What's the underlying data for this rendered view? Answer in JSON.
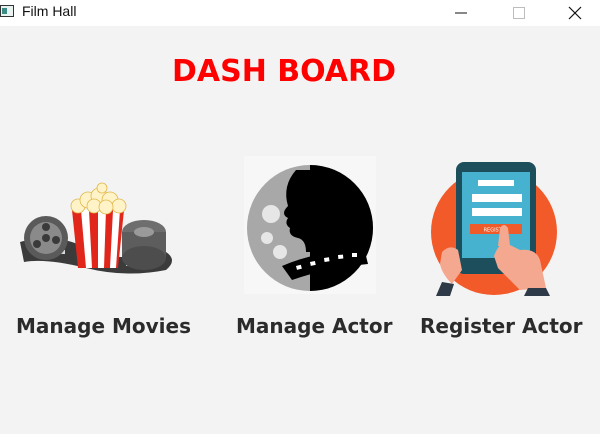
{
  "window": {
    "title": "Film Hall"
  },
  "header": {
    "title": "DASH BOARD"
  },
  "tiles": [
    {
      "label": "Manage Movies",
      "icon": "movies-popcorn-film-icon"
    },
    {
      "label": "Manage Actor",
      "icon": "actor-silhouette-icon"
    },
    {
      "label": "Register Actor",
      "icon": "tablet-register-icon",
      "register_text": "REGISTER"
    }
  ],
  "colors": {
    "title": "#ff0000",
    "background": "#f3f3f3",
    "label": "#2b2b2b"
  }
}
